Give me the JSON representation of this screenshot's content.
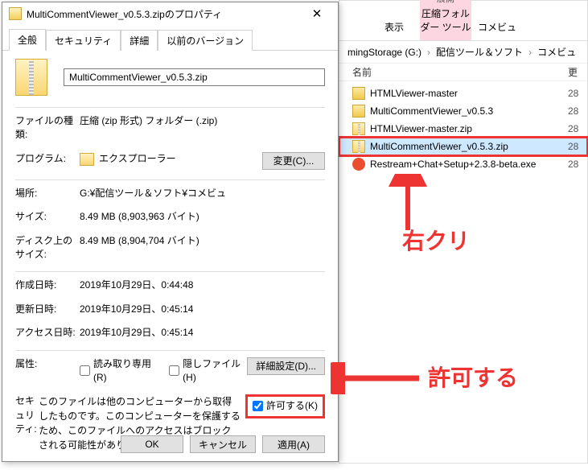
{
  "dialog": {
    "title": "MultiCommentViewer_v0.5.3.zipのプロパティ",
    "tabs": [
      "全般",
      "セキュリティ",
      "詳細",
      "以前のバージョン"
    ],
    "filename": "MultiCommentViewer_v0.5.3.zip",
    "rows": {
      "filetype_label": "ファイルの種類:",
      "filetype_value": "圧縮 (zip 形式) フォルダー (.zip)",
      "program_label": "プログラム:",
      "program_value": "エクスプローラー",
      "change_btn": "変更(C)...",
      "location_label": "場所:",
      "location_value": "G:¥配信ツール＆ソフト¥コメビュ",
      "size_label": "サイズ:",
      "size_value": "8.49 MB (8,903,963 バイト)",
      "disksize_label": "ディスク上のサイズ:",
      "disksize_value": "8.49 MB (8,904,704 バイト)",
      "created_label": "作成日時:",
      "created_value": "2019年10月29日、0:44:48",
      "modified_label": "更新日時:",
      "modified_value": "2019年10月29日、0:45:14",
      "accessed_label": "アクセス日時:",
      "accessed_value": "2019年10月29日、0:45:14",
      "attr_label": "属性:",
      "readonly_label": "読み取り専用(R)",
      "hidden_label": "隠しファイル(H)",
      "adv_btn": "詳細設定(D)...",
      "security_label": "セキュリティ:",
      "security_text": "このファイルは他のコンピューターから取得したものです。このコンピューターを保護するため、このファイルへのアクセスはブロックされる可能性があります。",
      "allow_label": "許可する(K)",
      "ok": "OK",
      "cancel": "キャンセル",
      "apply": "適用(A)"
    }
  },
  "explorer": {
    "ribbon": {
      "display": "表示",
      "tool_group": "圧縮フォルダー ツール",
      "expand": "展開",
      "komebi": "コメビュ"
    },
    "breadcrumb": [
      "mingStorage (G:)",
      "配信ツール＆ソフト",
      "コメビュ"
    ],
    "columns": {
      "name": "名前",
      "mod": "更"
    },
    "files": [
      {
        "type": "folder",
        "name": "HTMLViewer-master",
        "mod": "28"
      },
      {
        "type": "folder",
        "name": "MultiCommentViewer_v0.5.3",
        "mod": "28"
      },
      {
        "type": "zip",
        "name": "HTMLViewer-master.zip",
        "mod": "28"
      },
      {
        "type": "zip",
        "name": "MultiCommentViewer_v0.5.3.zip",
        "mod": "28",
        "selected": true
      },
      {
        "type": "exe",
        "name": "Restream+Chat+Setup+2.3.8-beta.exe",
        "mod": "28"
      }
    ]
  },
  "annotations": {
    "rightclick": "右クリ",
    "allow": "許可する"
  }
}
